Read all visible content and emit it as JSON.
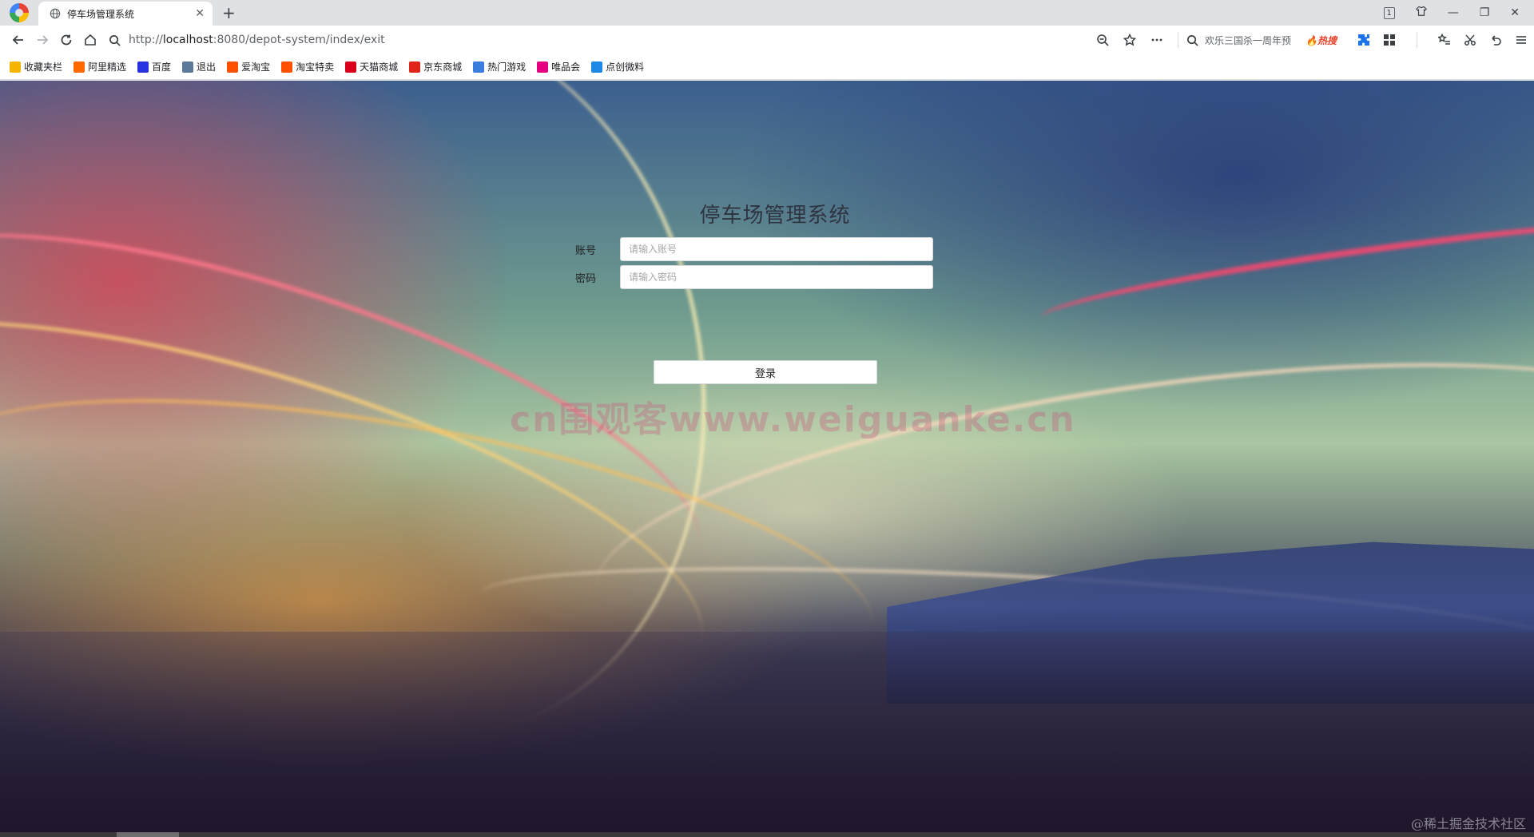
{
  "tab": {
    "title": "停车场管理系统"
  },
  "window": {
    "tab_count": "1"
  },
  "address": {
    "scheme": "http://",
    "host": "localhost",
    "path": ":8080/depot-system/index/exit"
  },
  "search": {
    "query": "欢乐三国杀一周年预",
    "hot": "热搜"
  },
  "bookmarks": [
    {
      "label": "收藏夹栏",
      "icon": "folder-icon",
      "color": "#f5b400"
    },
    {
      "label": "阿里精选",
      "icon": "ali-icon",
      "color": "#ff6a00"
    },
    {
      "label": "百度",
      "icon": "baidu-icon",
      "color": "#2932e1"
    },
    {
      "label": "退出",
      "icon": "image-icon",
      "color": "#5b7a99"
    },
    {
      "label": "爱淘宝",
      "icon": "taobao-icon",
      "color": "#ff5000"
    },
    {
      "label": "淘宝特卖",
      "icon": "taobao-sale-icon",
      "color": "#ff5000"
    },
    {
      "label": "天猫商城",
      "icon": "tmall-icon",
      "color": "#d9001b"
    },
    {
      "label": "京东商城",
      "icon": "jd-icon",
      "color": "#e1251b"
    },
    {
      "label": "热门游戏",
      "icon": "game-icon",
      "color": "#3b7ddd"
    },
    {
      "label": "唯品会",
      "icon": "vip-icon",
      "color": "#e4007f"
    },
    {
      "label": "点创微料",
      "icon": "dianchuang-icon",
      "color": "#1e88e5"
    }
  ],
  "login": {
    "title": "停车场管理系统",
    "account_label": "账号",
    "account_placeholder": "请输入账号",
    "password_label": "密码",
    "password_placeholder": "请输入密码",
    "submit_label": "登录"
  },
  "watermarks": {
    "center": "cn围观客www.weiguanke.cn",
    "corner": "@稀土掘金技术社区"
  }
}
